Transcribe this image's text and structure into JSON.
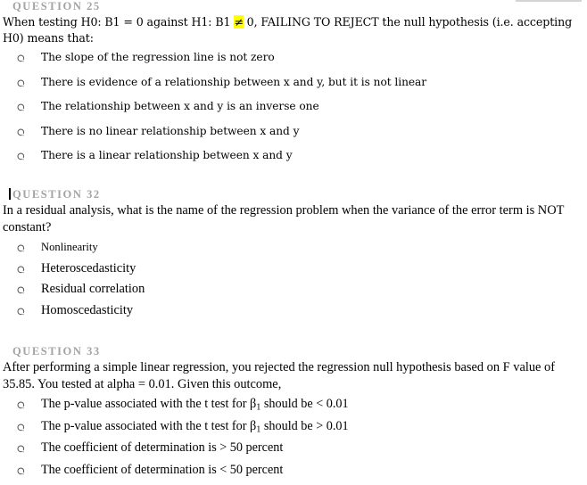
{
  "page": {
    "background_color": "#ffffff",
    "heading_color": "#a3a3a3",
    "text_color": "#000000",
    "highlight_color": "#ffff00",
    "top_rule_color": "#d4d4d4"
  },
  "questions": [
    {
      "heading": "QUESTION 25",
      "has_caret": false,
      "body_before_highlight": "When testing H0: B1 = 0 against H1: B1 ",
      "body_highlight": "≠",
      "body_after_highlight": " 0, FAILING TO REJECT the null hypothesis (i.e. accepting H0) means that:",
      "options": [
        {
          "label": "The slope of the regression line is not zero",
          "selected": false
        },
        {
          "label": "There is evidence of a relationship between x and y, but it is not linear",
          "selected": false
        },
        {
          "label": "The relationship between x and y is an inverse one",
          "selected": false
        },
        {
          "label": "There is no linear relationship between x and y",
          "selected": false
        },
        {
          "label": "There is a linear relationship between x and y",
          "selected": false
        }
      ]
    },
    {
      "heading": "QUESTION 32",
      "has_caret": true,
      "body": "In a residual analysis, what is the name of the regression problem when the variance of the error term is NOT constant?",
      "options": [
        {
          "label": "Nonlinearity",
          "selected": false,
          "small": true
        },
        {
          "label": "Heteroscedasticity",
          "selected": false,
          "small": false
        },
        {
          "label": "Residual correlation",
          "selected": false,
          "small": false
        },
        {
          "label": "Homoscedasticity",
          "selected": false,
          "small": false
        }
      ]
    },
    {
      "heading": "QUESTION 33",
      "has_caret": false,
      "body": "After performing a simple linear regression, you rejected the regression null hypothesis based on F value of 35.85. You tested at alpha = 0.01. Given this outcome,",
      "options": [
        {
          "label_pre": "The p-value associated with the t test for β",
          "sub": "1",
          "label_post": " should be < 0.01",
          "selected": false
        },
        {
          "label_pre": "The p-value associated with the t test for β",
          "sub": "1",
          "label_post": " should be > 0.01",
          "selected": false
        },
        {
          "label_pre": "The coefficient of determination is > 50 percent",
          "sub": "",
          "label_post": "",
          "selected": false
        },
        {
          "label_pre": "The coefficient of determination is < 50 percent",
          "sub": "",
          "label_post": "",
          "selected": false
        }
      ]
    }
  ]
}
